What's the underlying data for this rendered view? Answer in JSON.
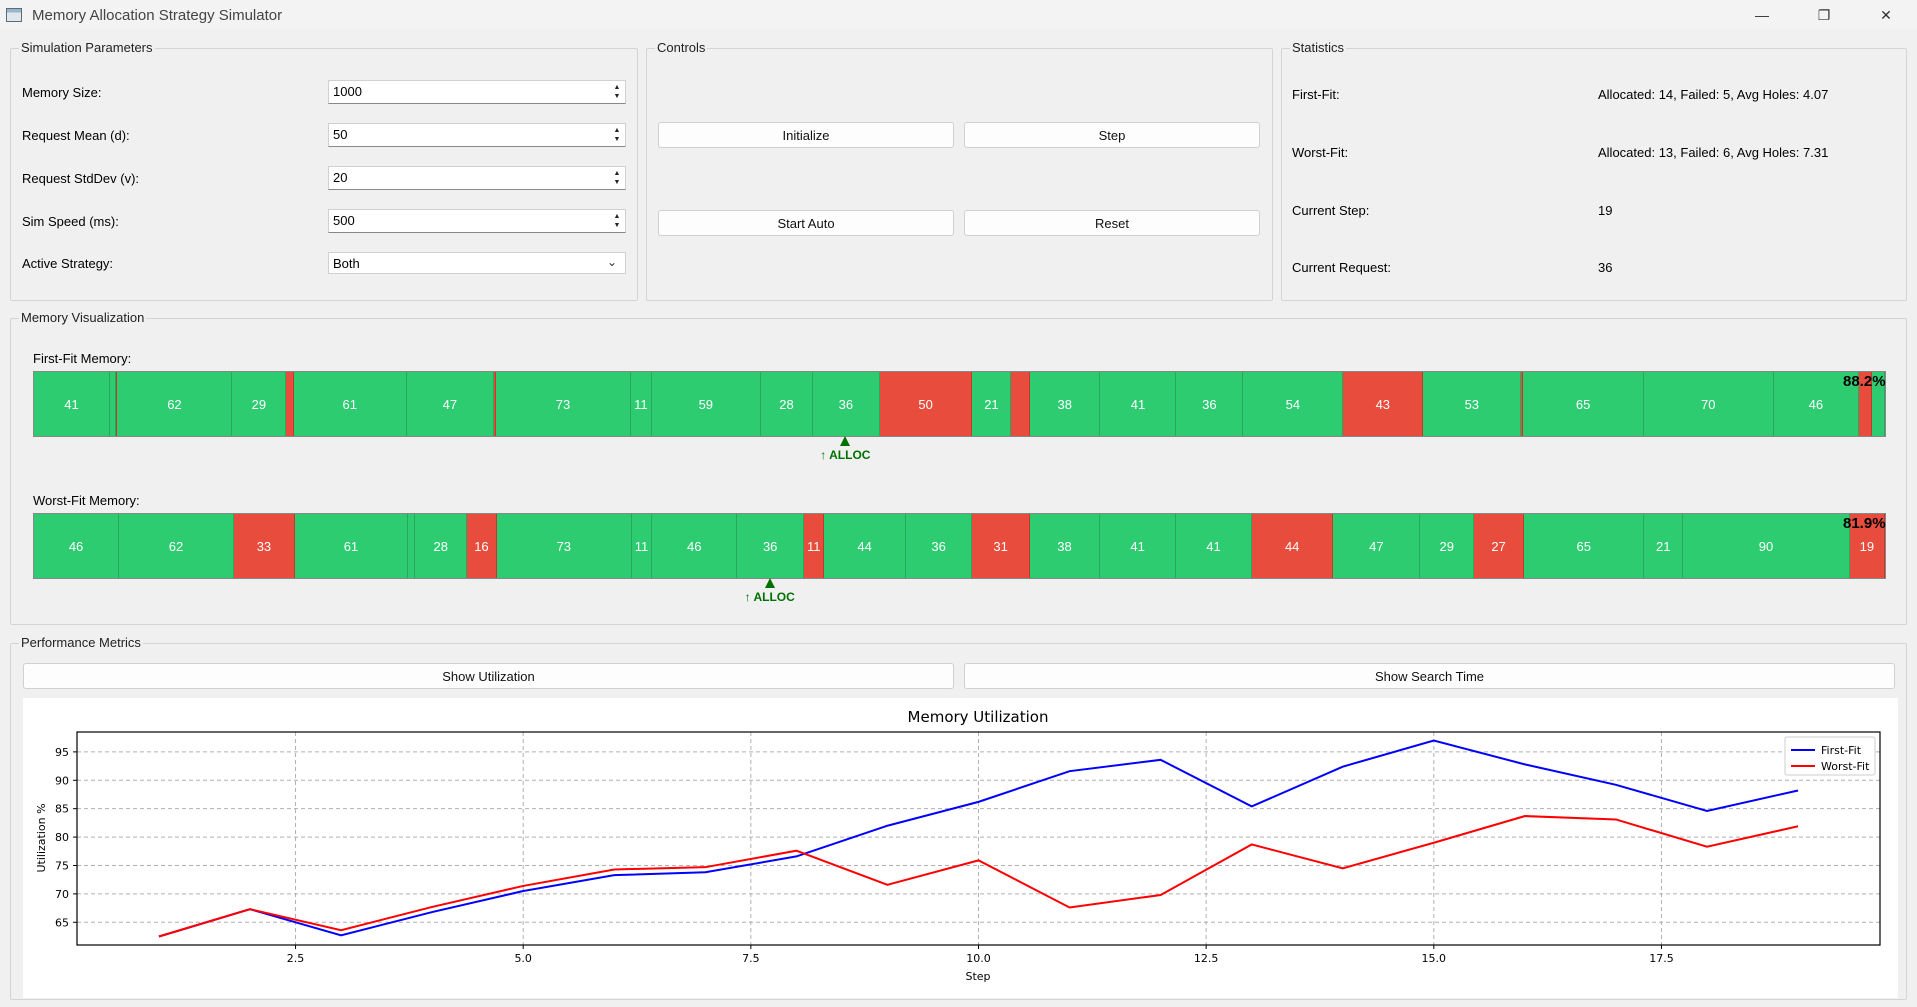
{
  "window": {
    "title": "Memory Allocation Strategy Simulator",
    "minimize": "—",
    "maximize": "❐",
    "close": "✕"
  },
  "params": {
    "title": "Simulation Parameters",
    "memory_size_label": "Memory Size:",
    "memory_size": "1000",
    "request_mean_label": "Request Mean (d):",
    "request_mean": "50",
    "request_stddev_label": "Request StdDev (v):",
    "request_stddev": "20",
    "sim_speed_label": "Sim Speed (ms):",
    "sim_speed": "500",
    "strategy_label": "Active Strategy:",
    "strategy": "Both"
  },
  "controls": {
    "title": "Controls",
    "initialize": "Initialize",
    "step": "Step",
    "start_auto": "Start Auto",
    "reset": "Reset"
  },
  "stats": {
    "title": "Statistics",
    "first_fit_label": "First-Fit:",
    "first_fit": "Allocated: 14, Failed: 5, Avg Holes: 4.07",
    "worst_fit_label": "Worst-Fit:",
    "worst_fit": "Allocated: 13, Failed: 6, Avg Holes: 7.31",
    "current_step_label": "Current Step:",
    "current_step": "19",
    "current_request_label": "Current Request:",
    "current_request": "36"
  },
  "visual": {
    "title": "Memory Visualization",
    "first_fit_label": "First-Fit Memory:",
    "first_fit_util": "88.2%",
    "worst_fit_label": "Worst-Fit Memory:",
    "worst_fit_util": "81.9%",
    "alloc_label": "↑ ALLOC",
    "first_fit_blocks": [
      {
        "v": "41",
        "s": 41,
        "t": "used"
      },
      {
        "v": "",
        "s": 3,
        "t": "used"
      },
      {
        "v": "",
        "s": 1,
        "t": "free"
      },
      {
        "v": "62",
        "s": 62,
        "t": "used"
      },
      {
        "v": "29",
        "s": 29,
        "t": "used"
      },
      {
        "v": "",
        "s": 4,
        "t": "free"
      },
      {
        "v": "61",
        "s": 61,
        "t": "used"
      },
      {
        "v": "47",
        "s": 47,
        "t": "used"
      },
      {
        "v": "",
        "s": 1,
        "t": "free"
      },
      {
        "v": "73",
        "s": 73,
        "t": "used"
      },
      {
        "v": "11",
        "s": 11,
        "t": "used"
      },
      {
        "v": "59",
        "s": 59,
        "t": "used"
      },
      {
        "v": "28",
        "s": 28,
        "t": "used"
      },
      {
        "v": "36",
        "s": 36,
        "t": "used"
      },
      {
        "v": "50",
        "s": 50,
        "t": "free"
      },
      {
        "v": "21",
        "s": 21,
        "t": "used"
      },
      {
        "v": "",
        "s": 10,
        "t": "free"
      },
      {
        "v": "38",
        "s": 38,
        "t": "used"
      },
      {
        "v": "41",
        "s": 41,
        "t": "used"
      },
      {
        "v": "36",
        "s": 36,
        "t": "used"
      },
      {
        "v": "54",
        "s": 54,
        "t": "used"
      },
      {
        "v": "43",
        "s": 43,
        "t": "free"
      },
      {
        "v": "53",
        "s": 53,
        "t": "used"
      },
      {
        "v": "",
        "s": 1,
        "t": "free"
      },
      {
        "v": "65",
        "s": 65,
        "t": "used"
      },
      {
        "v": "70",
        "s": 70,
        "t": "used"
      },
      {
        "v": "46",
        "s": 46,
        "t": "used"
      },
      {
        "v": "",
        "s": 7,
        "t": "free"
      },
      {
        "v": "",
        "s": 7,
        "t": "used"
      }
    ],
    "worst_fit_blocks": [
      {
        "v": "46",
        "s": 46,
        "t": "used"
      },
      {
        "v": "62",
        "s": 62,
        "t": "used"
      },
      {
        "v": "33",
        "s": 33,
        "t": "free"
      },
      {
        "v": "61",
        "s": 61,
        "t": "used"
      },
      {
        "v": "",
        "s": 4,
        "t": "used"
      },
      {
        "v": "28",
        "s": 28,
        "t": "used"
      },
      {
        "v": "16",
        "s": 16,
        "t": "free"
      },
      {
        "v": "73",
        "s": 73,
        "t": "used"
      },
      {
        "v": "11",
        "s": 11,
        "t": "used"
      },
      {
        "v": "46",
        "s": 46,
        "t": "used"
      },
      {
        "v": "36",
        "s": 36,
        "t": "used"
      },
      {
        "v": "11",
        "s": 11,
        "t": "free"
      },
      {
        "v": "44",
        "s": 44,
        "t": "used"
      },
      {
        "v": "36",
        "s": 36,
        "t": "used"
      },
      {
        "v": "31",
        "s": 31,
        "t": "free"
      },
      {
        "v": "38",
        "s": 38,
        "t": "used"
      },
      {
        "v": "41",
        "s": 41,
        "t": "used"
      },
      {
        "v": "41",
        "s": 41,
        "t": "used"
      },
      {
        "v": "44",
        "s": 44,
        "t": "free"
      },
      {
        "v": "47",
        "s": 47,
        "t": "used"
      },
      {
        "v": "29",
        "s": 29,
        "t": "used"
      },
      {
        "v": "27",
        "s": 27,
        "t": "free"
      },
      {
        "v": "65",
        "s": 65,
        "t": "used"
      },
      {
        "v": "21",
        "s": 21,
        "t": "used"
      },
      {
        "v": "90",
        "s": 90,
        "t": "used"
      },
      {
        "v": "19",
        "s": 19,
        "t": "free"
      }
    ],
    "first_fit_alloc_block": 13,
    "worst_fit_alloc_block": 10
  },
  "metrics": {
    "title": "Performance Metrics",
    "show_utilization": "Show Utilization",
    "show_search_time": "Show Search Time"
  },
  "chart_data": {
    "type": "line",
    "title": "Memory Utilization",
    "xlabel": "Step",
    "ylabel": "Utilization %",
    "xlim": [
      0.1,
      19.9
    ],
    "ylim": [
      61,
      98.5
    ],
    "xticks": [
      "2.5",
      "5.0",
      "7.5",
      "10.0",
      "12.5",
      "15.0",
      "17.5"
    ],
    "yticks": [
      "65",
      "70",
      "75",
      "80",
      "85",
      "90",
      "95"
    ],
    "grid": true,
    "legend_position": "top-right",
    "x": [
      1,
      2,
      3,
      4,
      5,
      6,
      7,
      8,
      9,
      10,
      11,
      12,
      13,
      14,
      15,
      16,
      17,
      18,
      19
    ],
    "series": [
      {
        "name": "First-Fit",
        "color": "#0000ff",
        "values": [
          62.5,
          67.3,
          62.7,
          66.8,
          70.5,
          73.3,
          73.8,
          76.6,
          82.0,
          86.2,
          91.6,
          93.6,
          85.4,
          92.4,
          97.0,
          92.8,
          89.2,
          84.6,
          88.2
        ]
      },
      {
        "name": "Worst-Fit",
        "color": "#ff0000",
        "values": [
          62.5,
          67.3,
          63.6,
          67.7,
          71.4,
          74.3,
          74.7,
          77.6,
          71.6,
          75.9,
          67.6,
          69.8,
          78.7,
          74.5,
          79.0,
          83.7,
          83.1,
          78.3,
          81.9
        ]
      }
    ]
  }
}
